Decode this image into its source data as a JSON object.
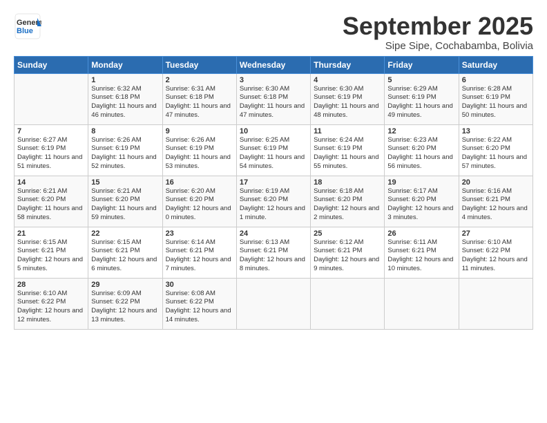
{
  "header": {
    "logo_general": "General",
    "logo_blue": "Blue",
    "month_title": "September 2025",
    "subtitle": "Sipe Sipe, Cochabamba, Bolivia"
  },
  "days_of_week": [
    "Sunday",
    "Monday",
    "Tuesday",
    "Wednesday",
    "Thursday",
    "Friday",
    "Saturday"
  ],
  "weeks": [
    [
      {
        "day": "",
        "sunrise": "",
        "sunset": "",
        "daylight": ""
      },
      {
        "day": "1",
        "sunrise": "Sunrise: 6:32 AM",
        "sunset": "Sunset: 6:18 PM",
        "daylight": "Daylight: 11 hours and 46 minutes."
      },
      {
        "day": "2",
        "sunrise": "Sunrise: 6:31 AM",
        "sunset": "Sunset: 6:18 PM",
        "daylight": "Daylight: 11 hours and 47 minutes."
      },
      {
        "day": "3",
        "sunrise": "Sunrise: 6:30 AM",
        "sunset": "Sunset: 6:18 PM",
        "daylight": "Daylight: 11 hours and 47 minutes."
      },
      {
        "day": "4",
        "sunrise": "Sunrise: 6:30 AM",
        "sunset": "Sunset: 6:19 PM",
        "daylight": "Daylight: 11 hours and 48 minutes."
      },
      {
        "day": "5",
        "sunrise": "Sunrise: 6:29 AM",
        "sunset": "Sunset: 6:19 PM",
        "daylight": "Daylight: 11 hours and 49 minutes."
      },
      {
        "day": "6",
        "sunrise": "Sunrise: 6:28 AM",
        "sunset": "Sunset: 6:19 PM",
        "daylight": "Daylight: 11 hours and 50 minutes."
      }
    ],
    [
      {
        "day": "7",
        "sunrise": "Sunrise: 6:27 AM",
        "sunset": "Sunset: 6:19 PM",
        "daylight": "Daylight: 11 hours and 51 minutes."
      },
      {
        "day": "8",
        "sunrise": "Sunrise: 6:26 AM",
        "sunset": "Sunset: 6:19 PM",
        "daylight": "Daylight: 11 hours and 52 minutes."
      },
      {
        "day": "9",
        "sunrise": "Sunrise: 6:26 AM",
        "sunset": "Sunset: 6:19 PM",
        "daylight": "Daylight: 11 hours and 53 minutes."
      },
      {
        "day": "10",
        "sunrise": "Sunrise: 6:25 AM",
        "sunset": "Sunset: 6:19 PM",
        "daylight": "Daylight: 11 hours and 54 minutes."
      },
      {
        "day": "11",
        "sunrise": "Sunrise: 6:24 AM",
        "sunset": "Sunset: 6:19 PM",
        "daylight": "Daylight: 11 hours and 55 minutes."
      },
      {
        "day": "12",
        "sunrise": "Sunrise: 6:23 AM",
        "sunset": "Sunset: 6:20 PM",
        "daylight": "Daylight: 11 hours and 56 minutes."
      },
      {
        "day": "13",
        "sunrise": "Sunrise: 6:22 AM",
        "sunset": "Sunset: 6:20 PM",
        "daylight": "Daylight: 11 hours and 57 minutes."
      }
    ],
    [
      {
        "day": "14",
        "sunrise": "Sunrise: 6:21 AM",
        "sunset": "Sunset: 6:20 PM",
        "daylight": "Daylight: 11 hours and 58 minutes."
      },
      {
        "day": "15",
        "sunrise": "Sunrise: 6:21 AM",
        "sunset": "Sunset: 6:20 PM",
        "daylight": "Daylight: 11 hours and 59 minutes."
      },
      {
        "day": "16",
        "sunrise": "Sunrise: 6:20 AM",
        "sunset": "Sunset: 6:20 PM",
        "daylight": "Daylight: 12 hours and 0 minutes."
      },
      {
        "day": "17",
        "sunrise": "Sunrise: 6:19 AM",
        "sunset": "Sunset: 6:20 PM",
        "daylight": "Daylight: 12 hours and 1 minute."
      },
      {
        "day": "18",
        "sunrise": "Sunrise: 6:18 AM",
        "sunset": "Sunset: 6:20 PM",
        "daylight": "Daylight: 12 hours and 2 minutes."
      },
      {
        "day": "19",
        "sunrise": "Sunrise: 6:17 AM",
        "sunset": "Sunset: 6:20 PM",
        "daylight": "Daylight: 12 hours and 3 minutes."
      },
      {
        "day": "20",
        "sunrise": "Sunrise: 6:16 AM",
        "sunset": "Sunset: 6:21 PM",
        "daylight": "Daylight: 12 hours and 4 minutes."
      }
    ],
    [
      {
        "day": "21",
        "sunrise": "Sunrise: 6:15 AM",
        "sunset": "Sunset: 6:21 PM",
        "daylight": "Daylight: 12 hours and 5 minutes."
      },
      {
        "day": "22",
        "sunrise": "Sunrise: 6:15 AM",
        "sunset": "Sunset: 6:21 PM",
        "daylight": "Daylight: 12 hours and 6 minutes."
      },
      {
        "day": "23",
        "sunrise": "Sunrise: 6:14 AM",
        "sunset": "Sunset: 6:21 PM",
        "daylight": "Daylight: 12 hours and 7 minutes."
      },
      {
        "day": "24",
        "sunrise": "Sunrise: 6:13 AM",
        "sunset": "Sunset: 6:21 PM",
        "daylight": "Daylight: 12 hours and 8 minutes."
      },
      {
        "day": "25",
        "sunrise": "Sunrise: 6:12 AM",
        "sunset": "Sunset: 6:21 PM",
        "daylight": "Daylight: 12 hours and 9 minutes."
      },
      {
        "day": "26",
        "sunrise": "Sunrise: 6:11 AM",
        "sunset": "Sunset: 6:21 PM",
        "daylight": "Daylight: 12 hours and 10 minutes."
      },
      {
        "day": "27",
        "sunrise": "Sunrise: 6:10 AM",
        "sunset": "Sunset: 6:22 PM",
        "daylight": "Daylight: 12 hours and 11 minutes."
      }
    ],
    [
      {
        "day": "28",
        "sunrise": "Sunrise: 6:10 AM",
        "sunset": "Sunset: 6:22 PM",
        "daylight": "Daylight: 12 hours and 12 minutes."
      },
      {
        "day": "29",
        "sunrise": "Sunrise: 6:09 AM",
        "sunset": "Sunset: 6:22 PM",
        "daylight": "Daylight: 12 hours and 13 minutes."
      },
      {
        "day": "30",
        "sunrise": "Sunrise: 6:08 AM",
        "sunset": "Sunset: 6:22 PM",
        "daylight": "Daylight: 12 hours and 14 minutes."
      },
      {
        "day": "",
        "sunrise": "",
        "sunset": "",
        "daylight": ""
      },
      {
        "day": "",
        "sunrise": "",
        "sunset": "",
        "daylight": ""
      },
      {
        "day": "",
        "sunrise": "",
        "sunset": "",
        "daylight": ""
      },
      {
        "day": "",
        "sunrise": "",
        "sunset": "",
        "daylight": ""
      }
    ]
  ]
}
